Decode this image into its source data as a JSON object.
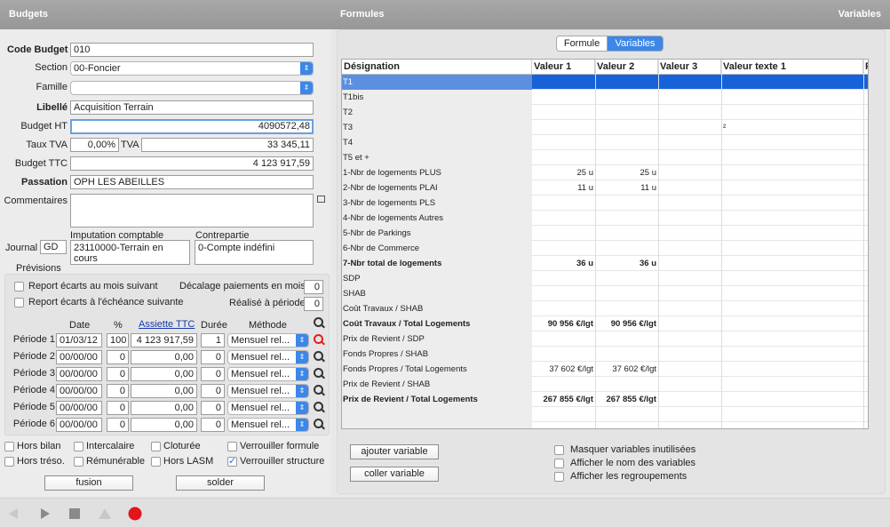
{
  "header": {
    "left": "Budgets",
    "center": "Formules",
    "right": "Variables"
  },
  "form": {
    "code_budget_label": "Code Budget",
    "code_budget": "010",
    "section_label": "Section",
    "section": "00-Foncier",
    "famille_label": "Famille",
    "famille": "",
    "libelle_label": "Libellé",
    "libelle": "Acquisition Terrain",
    "budget_ht_label": "Budget HT",
    "budget_ht": "4090572,48",
    "taux_tva_label": "Taux TVA",
    "taux_tva": "0,00%",
    "tva_label": "TVA",
    "tva": "33 345,11",
    "budget_ttc_label": "Budget TTC",
    "budget_ttc": "4 123 917,59",
    "passation_label": "Passation",
    "passation": "OPH LES ABEILLES",
    "commentaires_label": "Commentaires",
    "commentaires": "",
    "imputation_label": "Imputation comptable",
    "imputation": "23110000-Terrain en cours",
    "contrepartie_label": "Contrepartie",
    "contrepartie": "0-Compte indéfini",
    "journal_label": "Journal",
    "journal": "GD"
  },
  "previsions": {
    "title": "Prévisions",
    "report_mois": "Report écarts au mois suivant",
    "report_echeance": "Report écarts à l'échéance suivante",
    "decalage_label": "Décalage paiements en mois",
    "decalage": "0",
    "realise_label": "Réalisé à période",
    "realise": "0",
    "col_date": "Date",
    "col_pct": "%",
    "col_assiette": "Assiette TTC",
    "col_duree": "Durée",
    "col_methode": "Méthode",
    "periods": [
      {
        "label": "Période 1",
        "date": "01/03/12",
        "pct": "100",
        "assiette": "4 123 917,59",
        "duree": "1",
        "methode": "Mensuel rel..."
      },
      {
        "label": "Période 2",
        "date": "00/00/00",
        "pct": "0",
        "assiette": "0,00",
        "duree": "0",
        "methode": "Mensuel rel..."
      },
      {
        "label": "Période 3",
        "date": "00/00/00",
        "pct": "0",
        "assiette": "0,00",
        "duree": "0",
        "methode": "Mensuel rel..."
      },
      {
        "label": "Période 4",
        "date": "00/00/00",
        "pct": "0",
        "assiette": "0,00",
        "duree": "0",
        "methode": "Mensuel rel..."
      },
      {
        "label": "Période 5",
        "date": "00/00/00",
        "pct": "0",
        "assiette": "0,00",
        "duree": "0",
        "methode": "Mensuel rel..."
      },
      {
        "label": "Période 6",
        "date": "00/00/00",
        "pct": "0",
        "assiette": "0,00",
        "duree": "0",
        "methode": "Mensuel rel..."
      }
    ]
  },
  "options": {
    "hors_bilan": "Hors bilan",
    "intercalaire": "Intercalaire",
    "cloturee": "Cloturée",
    "verrouiller_formule": "Verrouiller formule",
    "hors_treso": "Hors tréso.",
    "remunerable": "Rémunérable",
    "hors_lasm": "Hors LASM",
    "verrouiller_structure": "Verrouiller structure"
  },
  "buttons": {
    "fusion": "fusion",
    "solder": "solder",
    "ajouter_variable": "ajouter variable",
    "coller_variable": "coller variable"
  },
  "tabs": {
    "formule": "Formule",
    "variables": "Variables"
  },
  "grid": {
    "headers": [
      "Désignation",
      "Valeur 1",
      "Valeur 2",
      "Valeur 3",
      "Valeur texte 1",
      "F"
    ],
    "rows": [
      {
        "name": "T1",
        "v1": "",
        "v2": "",
        "t1": "",
        "bold": false
      },
      {
        "name": "T1bis",
        "v1": "",
        "v2": "",
        "t1": "",
        "bold": false
      },
      {
        "name": "T2",
        "v1": "",
        "v2": "",
        "t1": "",
        "bold": false
      },
      {
        "name": "T3",
        "v1": "",
        "v2": "",
        "t1": "²",
        "bold": false
      },
      {
        "name": "T4",
        "v1": "",
        "v2": "",
        "t1": "",
        "bold": false
      },
      {
        "name": "T5 et +",
        "v1": "",
        "v2": "",
        "t1": "",
        "bold": false
      },
      {
        "name": "1-Nbr de logements PLUS",
        "v1": "25 u",
        "v2": "25 u",
        "t1": "",
        "bold": false
      },
      {
        "name": "2-Nbr de logements PLAI",
        "v1": "11 u",
        "v2": "11 u",
        "t1": "",
        "bold": false
      },
      {
        "name": "3-Nbr de logements PLS",
        "v1": "",
        "v2": "",
        "t1": "",
        "bold": false
      },
      {
        "name": "4-Nbr de logements Autres",
        "v1": "",
        "v2": "",
        "t1": "",
        "bold": false
      },
      {
        "name": "5-Nbr de Parkings",
        "v1": "",
        "v2": "",
        "t1": "",
        "bold": false
      },
      {
        "name": "6-Nbr de Commerce",
        "v1": "",
        "v2": "",
        "t1": "",
        "bold": false
      },
      {
        "name": "7-Nbr total de logements",
        "v1": "36 u",
        "v2": "36 u",
        "t1": "",
        "bold": true
      },
      {
        "name": "SDP",
        "v1": "",
        "v2": "",
        "t1": "",
        "bold": false
      },
      {
        "name": "SHAB",
        "v1": "",
        "v2": "",
        "t1": "",
        "bold": false
      },
      {
        "name": "Coût Travaux / SHAB",
        "v1": "",
        "v2": "",
        "t1": "",
        "bold": false
      },
      {
        "name": "Coût Travaux / Total Logements",
        "v1": "90 956 €/lgt",
        "v2": "90 956 €/lgt",
        "t1": "",
        "bold": true
      },
      {
        "name": "Prix de Revient / SDP",
        "v1": "",
        "v2": "",
        "t1": "",
        "bold": false
      },
      {
        "name": "Fonds Propres / SHAB",
        "v1": "",
        "v2": "",
        "t1": "",
        "bold": false
      },
      {
        "name": "Fonds Propres / Total Logements",
        "v1": "37 602 €/lgt",
        "v2": "37 602 €/lgt",
        "t1": "",
        "bold": false
      },
      {
        "name": "Prix de Revient / SHAB",
        "v1": "",
        "v2": "",
        "t1": "",
        "bold": false
      },
      {
        "name": "Prix de Revient / Total Logements",
        "v1": "267 855 €/lgt",
        "v2": "267 855 €/lgt",
        "t1": "",
        "bold": true
      }
    ]
  },
  "right_options": {
    "masquer": "Masquer variables inutilisées",
    "afficher_nom": "Afficher le nom des variables",
    "afficher_regroupements": "Afficher les regroupements"
  }
}
